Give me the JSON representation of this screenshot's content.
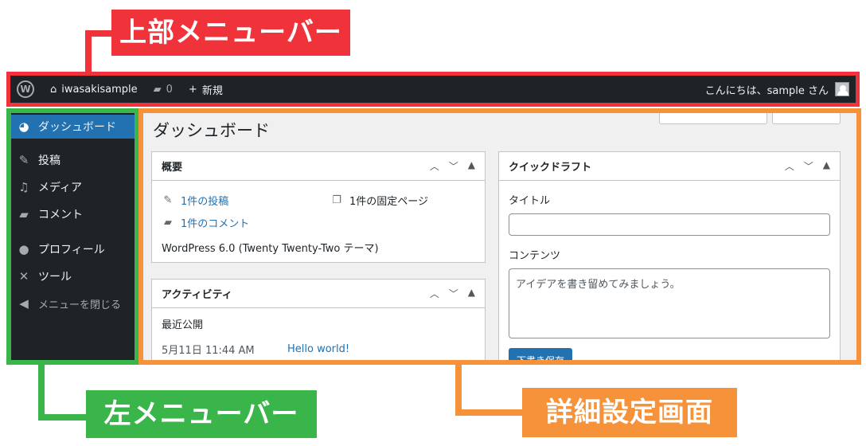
{
  "annotations": {
    "top_menu": "上部メニューバー",
    "left_menu": "左メニューバー",
    "detail": "詳細設定画面"
  },
  "adminbar": {
    "logo_icon": "wordpress-logo-icon",
    "site_name": "iwasakisample",
    "comments_count": "0",
    "new_label": "新規",
    "greeting": "こんにちは、sample さん"
  },
  "sidebar": {
    "items": [
      {
        "label": "ダッシュボード",
        "icon": "dashboard-icon"
      },
      {
        "label": "投稿",
        "icon": "pin-icon"
      },
      {
        "label": "メディア",
        "icon": "media-icon"
      },
      {
        "label": "コメント",
        "icon": "comment-icon"
      },
      {
        "label": "プロフィール",
        "icon": "user-icon"
      },
      {
        "label": "ツール",
        "icon": "wrench-icon"
      },
      {
        "label": "メニューを閉じる",
        "icon": "collapse-icon"
      }
    ]
  },
  "main": {
    "title": "ダッシュボード",
    "overview": {
      "heading": "概要",
      "posts": "1件の投稿",
      "pages": "1件の固定ページ",
      "comments": "1件のコメント",
      "version": "WordPress 6.0 (Twenty Twenty-Two テーマ)"
    },
    "activity": {
      "heading": "アクティビティ",
      "recent": "最近公開",
      "date": "5月11日 11:44 AM",
      "post_link": "Hello world!"
    },
    "quick_draft": {
      "heading": "クイックドラフト",
      "title_label": "タイトル",
      "content_label": "コンテンツ",
      "content_placeholder": "アイデアを書き留めてみましょう。",
      "save_label": "下書き保存"
    }
  },
  "colors": {
    "adminbar_bg": "#1d2327",
    "accent": "#2271b1",
    "callout_red": "#f0333a",
    "callout_green": "#3ab54a",
    "callout_orange": "#f6923a"
  }
}
